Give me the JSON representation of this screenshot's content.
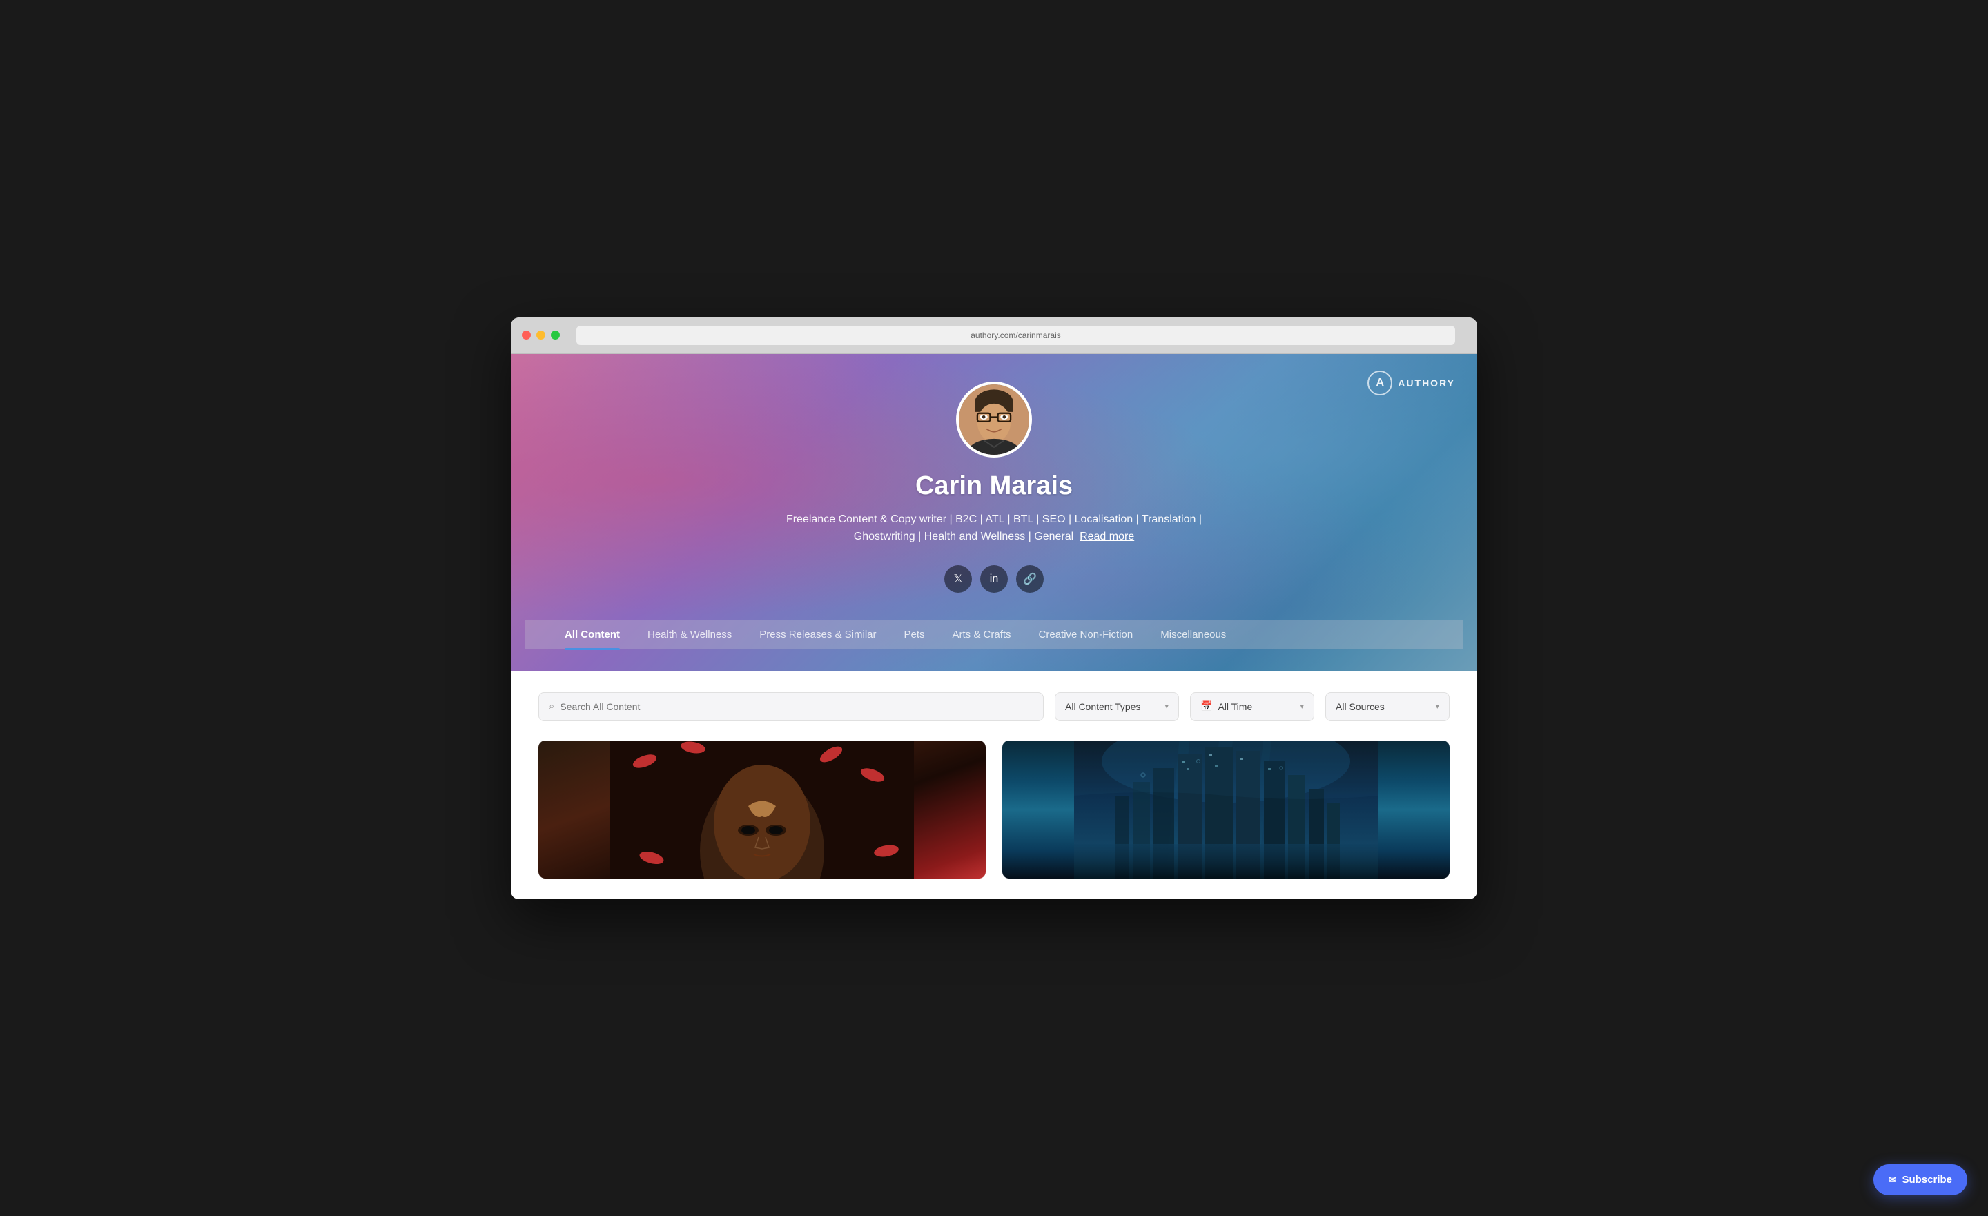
{
  "browser": {
    "address": "authory.com/carinmarais"
  },
  "logo": {
    "letter": "A",
    "name": "AUTHORY"
  },
  "profile": {
    "name": "Carin Marais",
    "bio": "Freelance Content & Copy writer | B2C | ATL | BTL | SEO | Localisation | Translation | Ghostwriting | Health and Wellness | General",
    "bio_link": "Read more",
    "avatar_alt": "Carin Marais profile photo"
  },
  "social": {
    "twitter_label": "Twitter",
    "linkedin_label": "LinkedIn",
    "link_label": "Website link"
  },
  "navigation": {
    "tabs": [
      {
        "label": "All Content",
        "active": true
      },
      {
        "label": "Health & Wellness",
        "active": false
      },
      {
        "label": "Press Releases & Similar",
        "active": false
      },
      {
        "label": "Pets",
        "active": false
      },
      {
        "label": "Arts & Crafts",
        "active": false
      },
      {
        "label": "Creative Non-Fiction",
        "active": false
      },
      {
        "label": "Miscellaneous",
        "active": false
      }
    ]
  },
  "filters": {
    "search_placeholder": "Search All Content",
    "content_types_label": "All Content Types",
    "date_label": "All Time",
    "sources_label": "All Sources"
  },
  "subscribe": {
    "label": "Subscribe"
  },
  "cards": [
    {
      "id": 1,
      "type": "face_image",
      "alt": "Article thumbnail 1"
    },
    {
      "id": 2,
      "type": "city_image",
      "alt": "Article thumbnail 2"
    }
  ]
}
